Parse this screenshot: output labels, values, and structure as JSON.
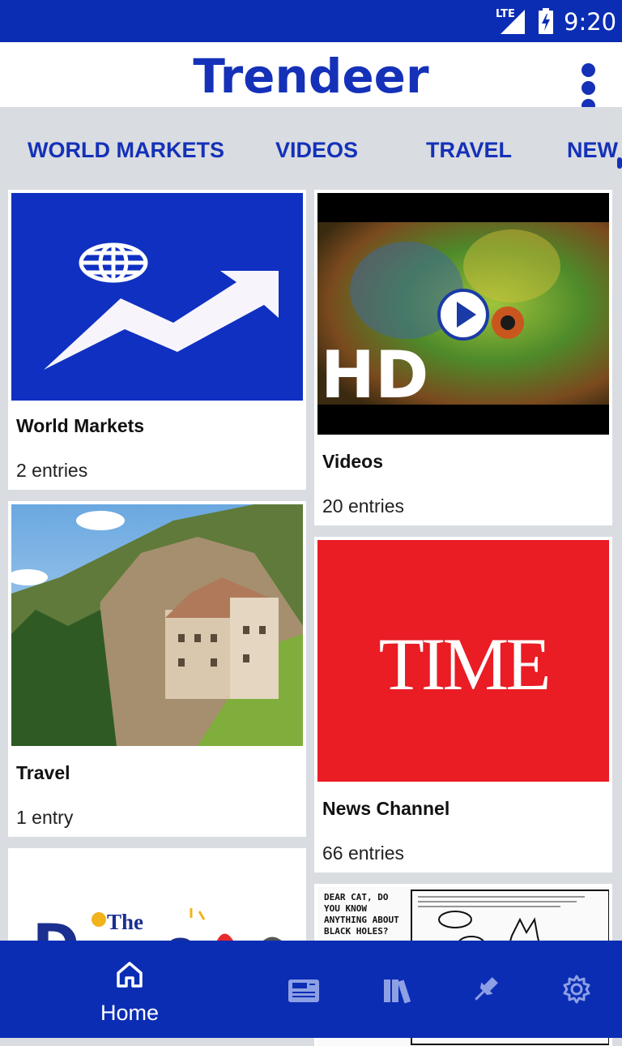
{
  "status": {
    "network": "LTE",
    "time": "9:20"
  },
  "app": {
    "title": "Trendeer"
  },
  "tabs": [
    "WORLD MARKETS",
    "VIDEOS",
    "TRAVEL",
    "NEW"
  ],
  "cards": [
    {
      "title": "World Markets",
      "count": "2 entries"
    },
    {
      "title": "Videos",
      "count": "20 entries",
      "thumb_text": "HD"
    },
    {
      "title": "Travel",
      "count": "1 entry"
    },
    {
      "title": "News Channel",
      "count": "66 entries",
      "thumb_text": "TIME"
    },
    {
      "title": "",
      "count": "",
      "thumb_text": "The"
    },
    {
      "title": "",
      "count": "",
      "thumb_text": "DEAR CAT, DO YOU KNOW ANYTHING ABOUT BLACK HOLES?"
    }
  ],
  "bottom_nav": {
    "home_label": "Home",
    "items": [
      "home-icon",
      "news-icon",
      "library-icon",
      "pin-icon",
      "settings-icon"
    ]
  },
  "colors": {
    "brand": "#0b2db4",
    "title": "#1431b8",
    "time_red": "#ea1c24",
    "markets_blue": "#0f30c1"
  }
}
